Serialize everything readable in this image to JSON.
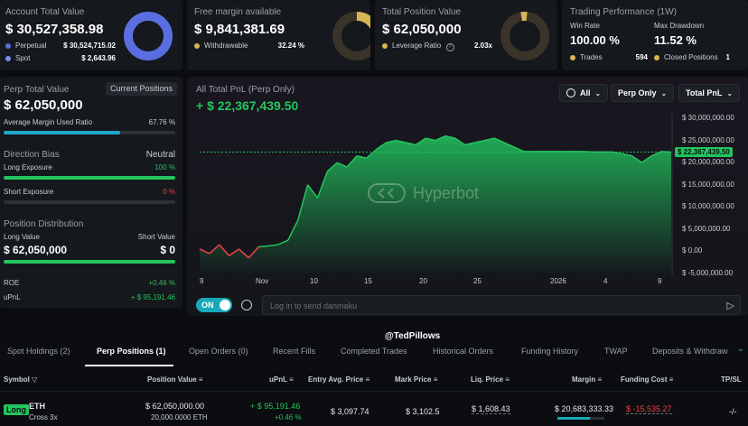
{
  "account": {
    "title": "Account Total Value",
    "value": "$ 30,527,358.98",
    "perpetual_label": "Perpetual",
    "perpetual_value": "$ 30,524,715.02",
    "spot_label": "Spot",
    "spot_value": "$ 2,643.96"
  },
  "margin": {
    "title": "Free margin available",
    "value": "$ 9,841,381.69",
    "withdrawable_label": "Withdrawable",
    "withdrawable_value": "32.24 %"
  },
  "position": {
    "title": "Total Position Value",
    "value": "$ 62,050,000",
    "leverage_label": "Leverage Ratio",
    "leverage_value": "2.03x"
  },
  "performance": {
    "title": "Trading Performance (1W)",
    "win_rate_label": "Win Rate",
    "win_rate": "100.00 %",
    "drawdown_label": "Max Drawdown",
    "drawdown": "11.52 %",
    "trades_label": "Trades",
    "trades": "594",
    "closed_label": "Closed Positions",
    "closed": "1"
  },
  "perp": {
    "title": "Perp Total Value",
    "button": "Current Positions",
    "value": "$ 62,050,000",
    "margin_used_label": "Average Margin Used Ratio",
    "margin_used": "67.76 %",
    "margin_used_fraction": 0.6776,
    "bias_label": "Direction Bias",
    "bias": "Neutral",
    "long_label": "Long Exposure",
    "long_pct": "100 %",
    "long_fraction": 1.0,
    "short_label": "Short Exposure",
    "short_pct": "0 %",
    "short_fraction": 0.0,
    "distribution_label": "Position Distribution",
    "long_value_label": "Long Value",
    "short_value_label": "Short Value",
    "long_value": "$ 62,050,000",
    "short_value": "$ 0",
    "long_value_fraction": 1.0,
    "roe_label": "ROE",
    "roe": "+0.46 %",
    "upnl_label": "uPnL",
    "upnl": "+ $ 95,191.46"
  },
  "pnl": {
    "title": "All Total PnL (Perp Only)",
    "value": "+ $ 22,367,439.50",
    "filter_all": "All",
    "filter_perp": "Perp Only",
    "filter_total": "Total PnL",
    "watermark": "Hyperbot",
    "current_label": "$ 22,367,439.50"
  },
  "danmaku": {
    "toggle": "ON",
    "placeholder": "Log in to send danmaku",
    "handle": "@TedPillows"
  },
  "tabs": [
    "Spot Holdings (2)",
    "Perp Positions (1)",
    "Open Orders (0)",
    "Recent Fills",
    "Completed Trades",
    "Historical Orders",
    "Funding History",
    "TWAP",
    "Deposits & Withdraw"
  ],
  "table": {
    "headers": [
      "Symbol",
      "Position Value",
      "uPnL",
      "Entry Avg. Price",
      "Mark Price",
      "Liq. Price",
      "Margin",
      "Funding Cost",
      "TP/SL"
    ],
    "row": {
      "side": "Long",
      "symbol": "ETH",
      "mode": "Cross 3x",
      "position_value": "$ 62,050,000.00",
      "position_size": "20,000.0000 ETH",
      "upnl": "+ $ 95,191.46",
      "upnl_pct": "+0.46 %",
      "entry": "$ 3,097.74",
      "mark": "$ 3,102.5",
      "liq": "$ 1,608.43",
      "margin": "$ 20,683,333.33",
      "funding": "$ -15,535.27",
      "tpsl": "-/-"
    }
  },
  "colors": {
    "accent_green": "#22c55e",
    "donut_blue": "#5b6ee1",
    "donut_gold": "#d9b454",
    "negative_red": "#ef4444"
  },
  "chart_data": {
    "type": "area",
    "x_ticks": [
      "9",
      "Nov",
      "10",
      "15",
      "20",
      "25",
      "2026",
      "4",
      "9"
    ],
    "y_ticks": [
      "$ 30,000,000.00",
      "$ 25,000,000.00",
      "$ 20,000,000.00",
      "$ 15,000,000.00",
      "$ 10,000,000.00",
      "$ 5,000,000.00",
      "$ 0.00",
      "$ -5,000,000.00"
    ],
    "ylim": [
      -5000000,
      30000000
    ],
    "current": 22367439.5,
    "series": [
      {
        "values": [
          500000,
          -500000,
          1500000,
          -1000000,
          500000,
          -1500000,
          1000000,
          1200000,
          1500000,
          2500000,
          7000000,
          15000000,
          12000000,
          18000000,
          20000000,
          19000000,
          21500000,
          21000000,
          23000000,
          24500000,
          25000000,
          24500000,
          24000000,
          25500000,
          25000000,
          26000000,
          25500000,
          24000000,
          24500000,
          25000000,
          25500000,
          24500000,
          23500000,
          22500000,
          22500000,
          22500000,
          22500000,
          22500000,
          22500000,
          22500000,
          22400000,
          22400000,
          22400000,
          22000000,
          21500000,
          20000000,
          21500000,
          22500000,
          22367439.5
        ]
      }
    ]
  }
}
